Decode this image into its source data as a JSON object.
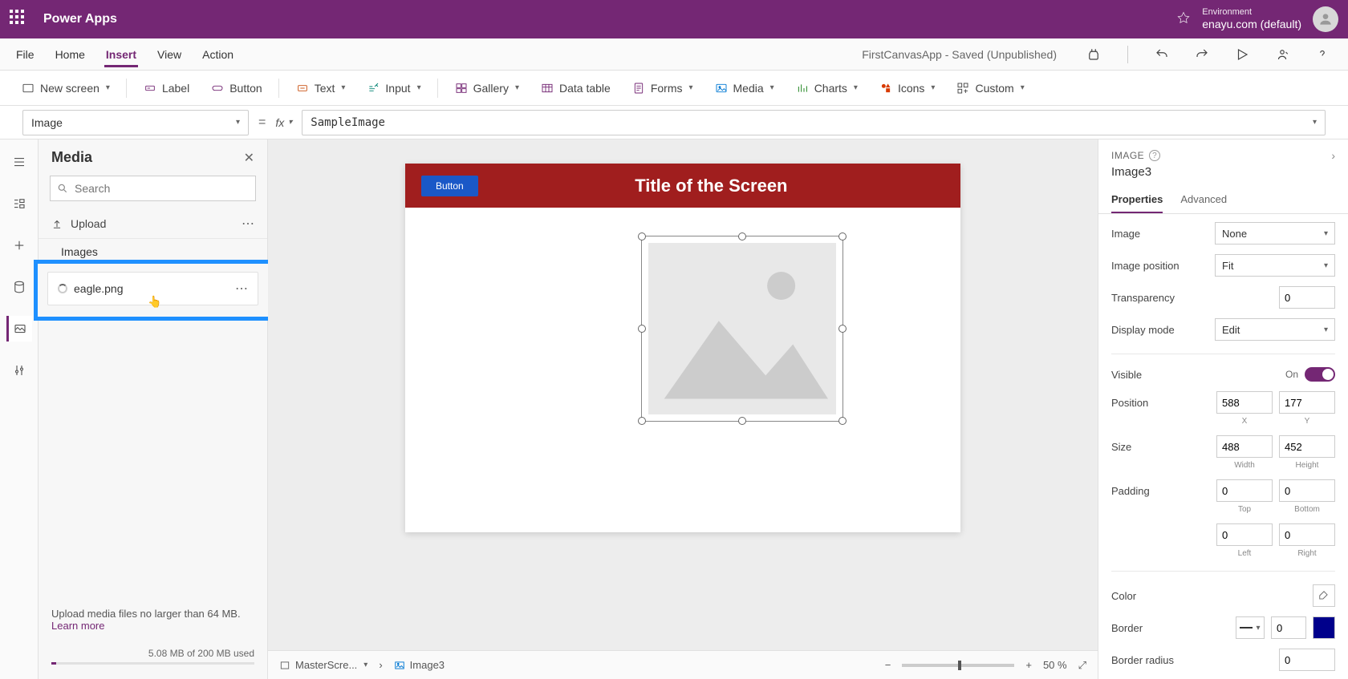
{
  "app": {
    "name": "Power Apps"
  },
  "environment": {
    "label": "Environment",
    "value": "enayu.com (default)"
  },
  "menubar": {
    "items": [
      "File",
      "Home",
      "Insert",
      "View",
      "Action"
    ],
    "active": "Insert"
  },
  "docstatus": "FirstCanvasApp - Saved (Unpublished)",
  "ribbon": {
    "new_screen": "New screen",
    "label": "Label",
    "button": "Button",
    "text": "Text",
    "input": "Input",
    "gallery": "Gallery",
    "datatable": "Data table",
    "forms": "Forms",
    "media": "Media",
    "charts": "Charts",
    "icons": "Icons",
    "custom": "Custom"
  },
  "formula": {
    "property": "Image",
    "value": "SampleImage"
  },
  "media_panel": {
    "title": "Media",
    "search_placeholder": "Search",
    "upload": "Upload",
    "category": "Images",
    "item": "eagle.png",
    "footer_text": "Upload media files no larger than 64 MB.",
    "learn_more": "Learn more",
    "storage": "5.08 MB of 200 MB used"
  },
  "canvas": {
    "title": "Title of the Screen",
    "button": "Button"
  },
  "bottombar": {
    "breadcrumb1": "MasterScre...",
    "breadcrumb2": "Image3",
    "zoom": "50",
    "zoom_unit": "%"
  },
  "properties": {
    "type": "IMAGE",
    "name": "Image3",
    "tabs": [
      "Properties",
      "Advanced"
    ],
    "active_tab": "Properties",
    "image_label": "Image",
    "image_value": "None",
    "position_label": "Image position",
    "position_value": "Fit",
    "transparency_label": "Transparency",
    "transparency_value": "0",
    "display_mode_label": "Display mode",
    "display_mode_value": "Edit",
    "visible_label": "Visible",
    "visible_value": "On",
    "pos_label": "Position",
    "pos_x": "588",
    "pos_y": "177",
    "x_lbl": "X",
    "y_lbl": "Y",
    "size_label": "Size",
    "size_w": "488",
    "size_h": "452",
    "w_lbl": "Width",
    "h_lbl": "Height",
    "padding_label": "Padding",
    "pad_t": "0",
    "pad_b": "0",
    "pad_l": "0",
    "pad_r": "0",
    "t_lbl": "Top",
    "b_lbl": "Bottom",
    "l_lbl": "Left",
    "r_lbl": "Right",
    "color_label": "Color",
    "border_label": "Border",
    "border_width": "0",
    "radius_label": "Border radius",
    "radius_value": "0"
  }
}
